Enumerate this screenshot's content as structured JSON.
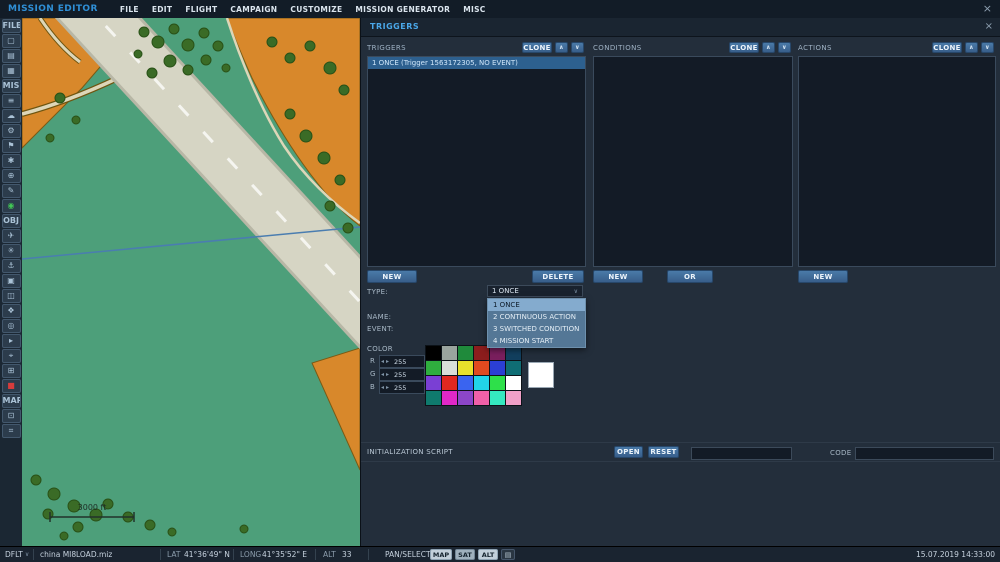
{
  "window": {
    "title": "MISSION EDITOR",
    "close_label": "×"
  },
  "menu": {
    "items": [
      "FILE",
      "EDIT",
      "FLIGHT",
      "CAMPAIGN",
      "CUSTOMIZE",
      "MISSION GENERATOR",
      "MISC"
    ]
  },
  "icons": {
    "up": "∧",
    "down": "∨",
    "dd_caret": "∨",
    "profile_caret": "∨",
    "spin_left": "◂",
    "spin_right": "▸",
    "layers": "▤",
    "record": "⊘"
  },
  "sidebar": {
    "entries": [
      {
        "label": "FILE",
        "cls": "sb-label",
        "name": "sidebar-section-file",
        "inter": "false"
      },
      {
        "glyph": "▢",
        "name": "new-mission-icon"
      },
      {
        "glyph": "▤",
        "name": "open-mission-icon"
      },
      {
        "glyph": "▦",
        "name": "save-mission-icon"
      },
      {
        "label": "MIS",
        "cls": "sb-label",
        "name": "sidebar-section-mis",
        "inter": "false"
      },
      {
        "glyph": "≡",
        "name": "briefing-icon"
      },
      {
        "glyph": "☁",
        "name": "weather-icon"
      },
      {
        "glyph": "⚙",
        "name": "mission-options-icon"
      },
      {
        "glyph": "⚑",
        "name": "goals-icon"
      },
      {
        "glyph": "✱",
        "name": "failures-icon"
      },
      {
        "glyph": "⊕",
        "name": "resources-icon"
      },
      {
        "glyph": "✎",
        "name": "notes-icon"
      },
      {
        "glyph": "◉",
        "cls": "sb-green",
        "name": "fly-mission-icon"
      },
      {
        "label": "OBJ",
        "cls": "sb-label",
        "name": "sidebar-section-obj",
        "inter": "false"
      },
      {
        "glyph": "✈",
        "name": "airplane-group-icon"
      },
      {
        "glyph": "✳",
        "name": "helicopter-group-icon"
      },
      {
        "glyph": "⚓",
        "name": "ship-group-icon"
      },
      {
        "glyph": "▣",
        "name": "vehicle-group-icon"
      },
      {
        "glyph": "◫",
        "name": "static-object-icon"
      },
      {
        "glyph": "❖",
        "name": "template-icon"
      },
      {
        "glyph": "◎",
        "name": "trigger-zone-icon"
      },
      {
        "glyph": "▸",
        "name": "waypoint-icon"
      },
      {
        "glyph": "⌖",
        "name": "measure-tool-icon"
      },
      {
        "glyph": "⊞",
        "name": "grid-snap-icon"
      },
      {
        "glyph": "■",
        "cls": "sb-red",
        "name": "restricted-zone-icon"
      },
      {
        "label": "MAP",
        "cls": "sb-label",
        "name": "sidebar-section-map",
        "inter": "false"
      },
      {
        "glyph": "⊡",
        "name": "map-layers-icon"
      },
      {
        "glyph": "⌗",
        "name": "map-grid-icon"
      }
    ]
  },
  "map": {
    "scale_label": "3000 ft"
  },
  "panel": {
    "title": "TRIGGERS",
    "close_label": "×",
    "columns": [
      {
        "label": "TRIGGERS",
        "clone_label": "CLONE",
        "items": [
          "1 ONCE (Trigger 1563172305, NO EVENT)"
        ]
      },
      {
        "label": "CONDITIONS",
        "clone_label": "CLONE",
        "items": []
      },
      {
        "label": "ACTIONS",
        "clone_label": "CLONE",
        "items": []
      }
    ],
    "buttons": {
      "new_trigger": "NEW",
      "delete_trigger": "DELETE",
      "new_condition": "NEW",
      "or_condition": "OR",
      "new_action": "NEW"
    },
    "form": {
      "type_label": "TYPE:",
      "type_value": "1 ONCE",
      "type_options": [
        "1 ONCE",
        "2 CONTINUOUS ACTION",
        "3 SWITCHED CONDITION",
        "4 MISSION START"
      ],
      "name_label": "NAME:",
      "event_label": "EVENT:",
      "color_label": "COLOR",
      "rgb": [
        {
          "label": "R",
          "value": "255"
        },
        {
          "label": "G",
          "value": "255"
        },
        {
          "label": "B",
          "value": "255"
        }
      ],
      "palette": [
        {
          "color": "#000000"
        },
        {
          "color": "#9aa49e"
        },
        {
          "color": "#1f8a3b"
        },
        {
          "color": "#8c1d1d"
        },
        {
          "color": "#7a1f5e"
        },
        {
          "color": "#123f5e"
        },
        {
          "color": "#2fae3e"
        },
        {
          "color": "#d9ded9"
        },
        {
          "color": "#e8e12b"
        },
        {
          "color": "#e04a1f"
        },
        {
          "color": "#2b3fd4"
        },
        {
          "color": "#0f6d74"
        },
        {
          "color": "#7a3fd4"
        },
        {
          "color": "#e0281f"
        },
        {
          "color": "#3a64f0"
        },
        {
          "color": "#22d4e8"
        },
        {
          "color": "#2ee04a"
        },
        {
          "color": "#ffffff"
        },
        {
          "color": "#0f7a6d"
        },
        {
          "color": "#e028c8"
        },
        {
          "color": "#8c46c8"
        },
        {
          "color": "#f060a8"
        },
        {
          "color": "#35e8c0"
        },
        {
          "color": "#f0a0c8"
        }
      ],
      "preview_color": "#ffffff"
    },
    "script": {
      "label": "INITIALIZATION SCRIPT",
      "open_label": "OPEN",
      "reset_label": "RESET",
      "code_label": "CODE"
    }
  },
  "statusbar": {
    "profile": "DFLT",
    "unit": "china MI8",
    "file": "LOAD.miz",
    "lat_label": "LAT",
    "lat_value": "41°36'49\" N",
    "long_label": "LONG",
    "long_value": "41°35'52\" E",
    "alt_label": "ALT",
    "alt_value": "33",
    "mode": "PAN/SELECT",
    "map_toggle": "MAP",
    "sat_toggle": "SAT",
    "alt_toggle": "ALT",
    "datetime": "15.07.2019 14:33:00"
  }
}
